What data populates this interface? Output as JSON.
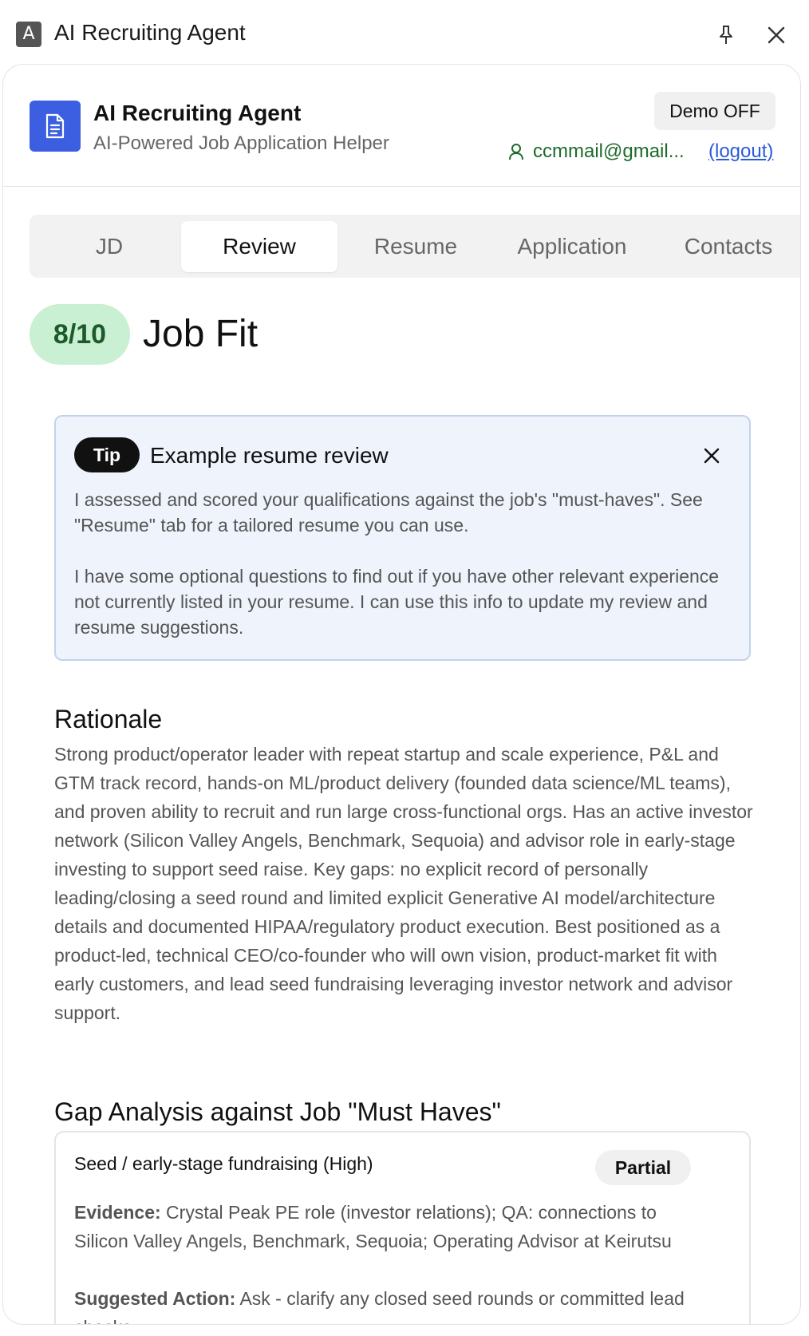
{
  "window": {
    "icon_letter": "A",
    "title": "AI Recruiting Agent"
  },
  "header": {
    "title": "AI Recruiting Agent",
    "subtitle": "AI-Powered Job Application Helper",
    "demo_button": "Demo OFF",
    "user_email": "ccmmail@gmail...",
    "logout_label": "(logout)"
  },
  "tabs": [
    {
      "label": "JD",
      "active": false
    },
    {
      "label": "Review",
      "active": true
    },
    {
      "label": "Resume",
      "active": false
    },
    {
      "label": "Application",
      "active": false
    },
    {
      "label": "Contacts",
      "active": false
    }
  ],
  "review": {
    "score": "8/10",
    "title": "Job Fit",
    "tip": {
      "badge": "Tip",
      "title": "Example resume review",
      "paragraph1": "I assessed and scored your qualifications against the job's \"must-haves\". See \"Resume\" tab for a tailored resume you can use.",
      "paragraph2": "I have some optional questions to find out if you have other relevant experience not currently listed in your resume. I can use this info to update my review and resume suggestions."
    },
    "rationale_heading": "Rationale",
    "rationale_text": "Strong product/operator leader with repeat startup and scale experience, P&L and GTM track record, hands-on ML/product delivery (founded data science/ML teams), and proven ability to recruit and run large cross-functional orgs. Has an active investor network (Silicon Valley Angels, Benchmark, Sequoia) and advisor role in early-stage investing to support seed raise. Key gaps: no explicit record of personally leading/closing a seed round and limited explicit Generative AI model/architecture details and documented HIPAA/regulatory product execution. Best positioned as a product-led, technical CEO/co-founder who will own vision, product-market fit with early customers, and lead seed fundraising leveraging investor network and advisor support.",
    "gap_heading": "Gap Analysis against Job \"Must Haves\"",
    "gaps": [
      {
        "title": "Seed / early-stage fundraising (High)",
        "status": "Partial",
        "evidence_label": "Evidence:",
        "evidence": "Crystal Peak PE role (investor relations); QA: connections to Silicon Valley Angels, Benchmark, Sequoia; Operating Advisor at Keirutsu",
        "action_label": "Suggested Action:",
        "action": "Ask - clarify any closed seed rounds or committed lead checks"
      }
    ]
  },
  "colors": {
    "brand_blue": "#3b5fe0",
    "score_bg": "#c9f0d2",
    "score_text": "#1d5a2a",
    "tip_bg": "#eef3fc",
    "tip_border": "#c3d3ee",
    "email_green": "#1d6b2a",
    "link_blue": "#2a5bd7"
  }
}
